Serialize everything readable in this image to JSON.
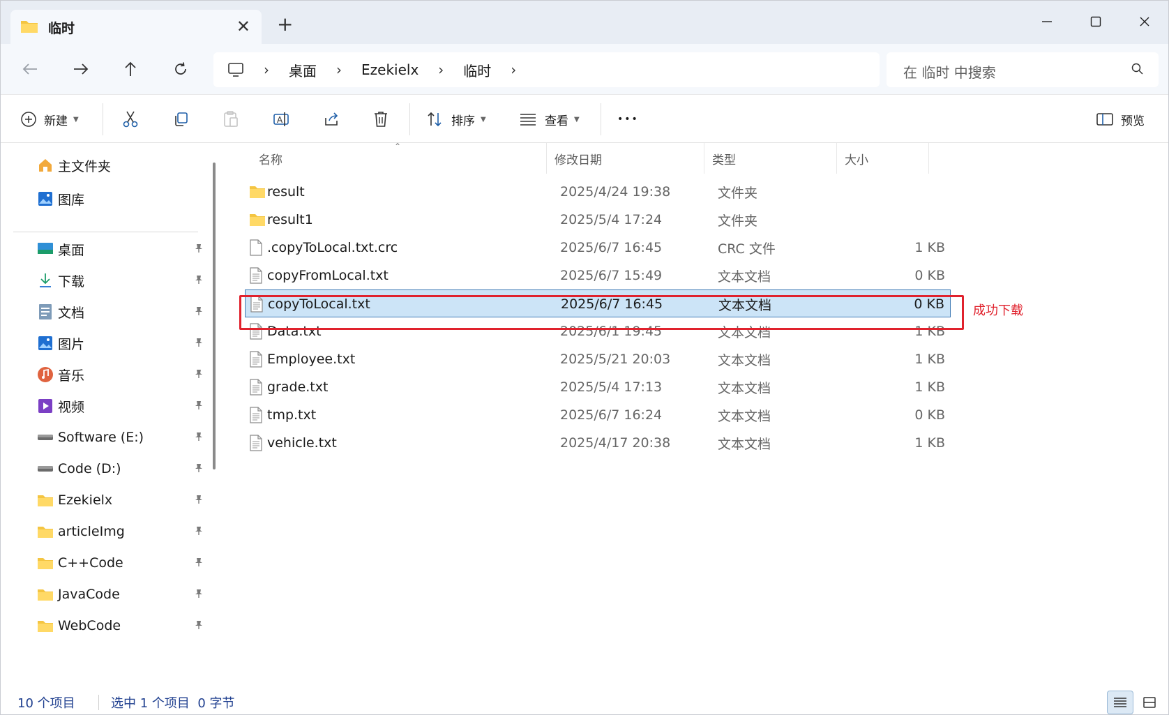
{
  "tab": {
    "title": "临时",
    "close_glyph": "✕",
    "new_tab_glyph": "+"
  },
  "window_controls": {
    "minimize": "—",
    "maximize": "☐",
    "close": "✕"
  },
  "nav": {
    "back_glyph": "←",
    "forward_glyph": "→",
    "up_glyph": "↑",
    "refresh_glyph": "↻"
  },
  "breadcrumb": {
    "sep": "›",
    "items": [
      "桌面",
      "Ezekielx",
      "临时"
    ]
  },
  "search": {
    "placeholder": "在 临时 中搜索"
  },
  "toolbar": {
    "new_label": "新建",
    "sort_label": "排序",
    "view_label": "查看",
    "more_glyph": "•••",
    "preview_label": "预览"
  },
  "sidebar": {
    "top_items": [
      {
        "label": "主文件夹",
        "icon": "home-icon"
      },
      {
        "label": "图库",
        "icon": "gallery-icon"
      }
    ],
    "pinned_items": [
      {
        "label": "桌面",
        "icon": "desktop-icon"
      },
      {
        "label": "下载",
        "icon": "download-icon"
      },
      {
        "label": "文档",
        "icon": "document-icon"
      },
      {
        "label": "图片",
        "icon": "pictures-icon"
      },
      {
        "label": "音乐",
        "icon": "music-icon"
      },
      {
        "label": "视频",
        "icon": "video-icon"
      },
      {
        "label": "Software (E:)",
        "icon": "drive-icon"
      },
      {
        "label": "Code (D:)",
        "icon": "drive-icon"
      },
      {
        "label": "Ezekielx",
        "icon": "folder-icon"
      },
      {
        "label": "articleImg",
        "icon": "folder-icon"
      },
      {
        "label": "C++Code",
        "icon": "folder-icon"
      },
      {
        "label": "JavaCode",
        "icon": "folder-icon"
      },
      {
        "label": "WebCode",
        "icon": "folder-icon"
      }
    ],
    "pin_glyph": "📌"
  },
  "columns": {
    "name": "名称",
    "modified": "修改日期",
    "type": "类型",
    "size": "大小",
    "sort_glyph": "⌃"
  },
  "files": [
    {
      "name": "result",
      "modified": "2025/4/24 19:38",
      "type": "文件夹",
      "size": "",
      "kind": "folder"
    },
    {
      "name": "result1",
      "modified": "2025/5/4 17:24",
      "type": "文件夹",
      "size": "",
      "kind": "folder"
    },
    {
      "name": ".copyToLocal.txt.crc",
      "modified": "2025/6/7 16:45",
      "type": "CRC 文件",
      "size": "1 KB",
      "kind": "file"
    },
    {
      "name": "copyFromLocal.txt",
      "modified": "2025/6/7 15:49",
      "type": "文本文档",
      "size": "0 KB",
      "kind": "text"
    },
    {
      "name": "copyToLocal.txt",
      "modified": "2025/6/7 16:45",
      "type": "文本文档",
      "size": "0 KB",
      "kind": "text",
      "selected": true
    },
    {
      "name": "Data.txt",
      "modified": "2025/6/1 19:45",
      "type": "文本文档",
      "size": "1 KB",
      "kind": "text"
    },
    {
      "name": "Employee.txt",
      "modified": "2025/5/21 20:03",
      "type": "文本文档",
      "size": "1 KB",
      "kind": "text"
    },
    {
      "name": "grade.txt",
      "modified": "2025/5/4 17:13",
      "type": "文本文档",
      "size": "1 KB",
      "kind": "text"
    },
    {
      "name": "tmp.txt",
      "modified": "2025/6/7 16:24",
      "type": "文本文档",
      "size": "0 KB",
      "kind": "text"
    },
    {
      "name": "vehicle.txt",
      "modified": "2025/4/17 20:38",
      "type": "文本文档",
      "size": "1 KB",
      "kind": "text"
    }
  ],
  "annotation": {
    "text": "成功下载",
    "color": "#e0222d"
  },
  "status": {
    "item_count": "10 个项目",
    "selection": "选中 1 个项目  0 字节"
  },
  "colors": {
    "selected_row": "#cce4f7",
    "accent": "#3d79b5",
    "folder": "#f4c542"
  }
}
